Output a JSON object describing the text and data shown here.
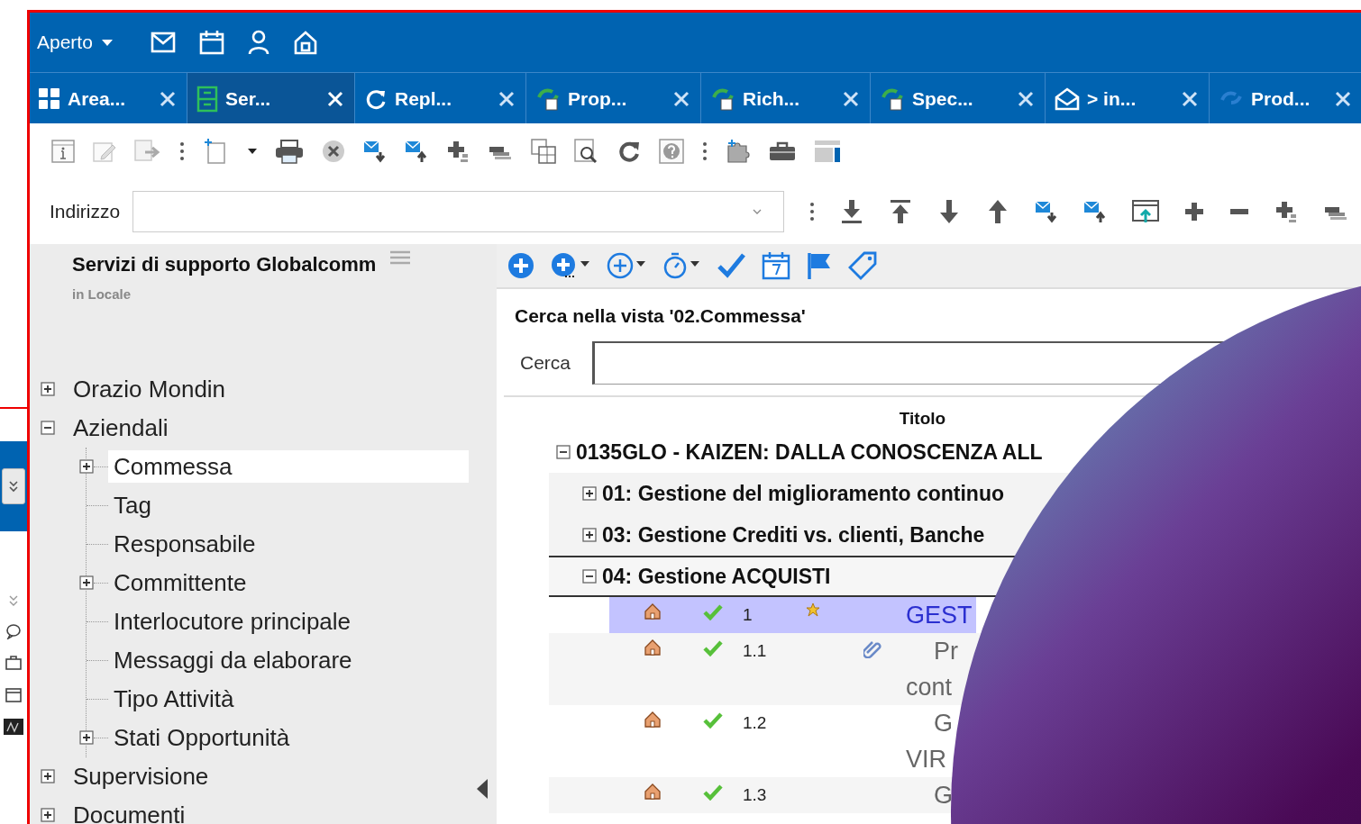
{
  "header": {
    "status": "Aperto"
  },
  "tabs": [
    {
      "label": "Area...",
      "selected": false
    },
    {
      "label": "Ser...",
      "selected": true
    },
    {
      "label": "Repl...",
      "selected": false
    },
    {
      "label": "Prop...",
      "selected": false
    },
    {
      "label": "Rich...",
      "selected": false
    },
    {
      "label": "Spec...",
      "selected": false
    },
    {
      "label": "> in...",
      "selected": false
    },
    {
      "label": "Prod...",
      "selected": false
    }
  ],
  "address": {
    "label": "Indirizzo"
  },
  "panel": {
    "title": "Servizi di supporto Globalcomm",
    "subtitle": "in Locale"
  },
  "tree": [
    {
      "label": "Orazio Mondin",
      "expanded": false
    },
    {
      "label": "Aziendali",
      "expanded": true,
      "children": [
        {
          "label": "Commessa",
          "expanded": false,
          "selected": true
        },
        {
          "label": "Tag",
          "selected": false
        },
        {
          "label": "Responsabile",
          "selected": false
        },
        {
          "label": "Committente",
          "expanded": false,
          "selected": false
        },
        {
          "label": "Interlocutore principale",
          "selected": false
        },
        {
          "label": "Messaggi da elaborare",
          "selected": false
        },
        {
          "label": "Tipo Attività",
          "selected": false
        },
        {
          "label": "Stati Opportunità",
          "expanded": false,
          "selected": false
        }
      ]
    },
    {
      "label": "Supervisione",
      "expanded": false
    },
    {
      "label": "Documenti",
      "expanded": false
    }
  ],
  "search": {
    "title": "Cerca nella vista '02.Commessa'",
    "label": "Cerca"
  },
  "grid": {
    "columns": [
      "Titolo"
    ],
    "rows": [
      {
        "kind": "group",
        "label": "0135GLO - KAIZEN: DALLA CONOSCENZA ALL",
        "expanded": true,
        "children": [
          {
            "kind": "group",
            "label": "01: Gestione del miglioramento continuo",
            "expanded": false
          },
          {
            "kind": "group",
            "label": "03: Gestione Crediti vs. clienti, Banche",
            "expanded": false
          },
          {
            "kind": "group",
            "label": "04: Gestione ACQUISTI",
            "expanded": true,
            "children": [
              {
                "kind": "task",
                "number": "1",
                "starred": true,
                "attachment": false,
                "selected": true,
                "title_lines": [
                  "GEST"
                ]
              },
              {
                "kind": "task",
                "number": "1.1",
                "starred": false,
                "attachment": true,
                "selected": false,
                "title_lines": [
                  "Pr",
                  "cont"
                ]
              },
              {
                "kind": "task",
                "number": "1.2",
                "starred": false,
                "attachment": false,
                "selected": false,
                "title_lines": [
                  "G",
                  "VIR"
                ]
              },
              {
                "kind": "task",
                "number": "1.3",
                "starred": false,
                "attachment": false,
                "selected": false,
                "title_lines": [
                  "G"
                ]
              }
            ]
          }
        ]
      }
    ]
  }
}
